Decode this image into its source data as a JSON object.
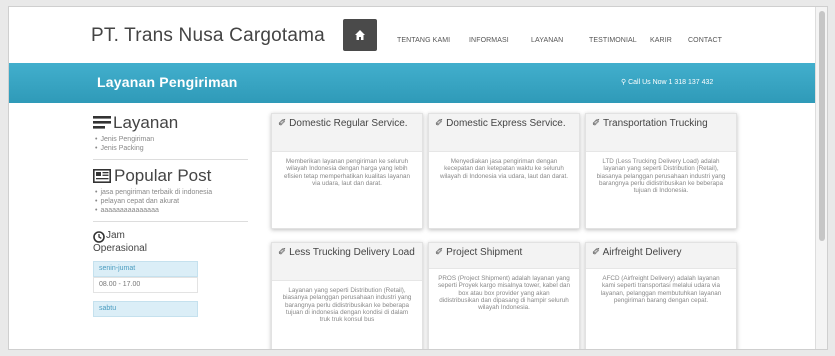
{
  "header": {
    "brand": "PT. Trans Nusa Cargotama",
    "home_icon": "home-icon",
    "nav": [
      "TENTANG KAMI",
      "INFORMASI",
      "LAYANAN",
      "TESTIMONIAL",
      "KARIR",
      "CONTACT"
    ]
  },
  "banner": {
    "title": "Layanan Pengiriman",
    "call": "⚲ Call Us Now 1 318 137 432",
    "color": "#3aa6c5"
  },
  "sidebar": {
    "layanan": {
      "title": "Layanan",
      "icon": "list-icon",
      "items": [
        "Jenis Pengiriman",
        "Jenis Packing"
      ]
    },
    "popular": {
      "title": "Popular Post",
      "icon": "news-icon",
      "items": [
        "jasa pengiriman terbaik di indonesia",
        "pelayan cepat dan akurat",
        "aaaaaaaaaaaaaaa"
      ]
    },
    "jam": {
      "title_line1": "Jam",
      "title_line2": "Operasional",
      "icon": "clock-icon",
      "rows": [
        "senin-jumat",
        "08.00 - 17.00",
        "sabtu"
      ]
    }
  },
  "services": [
    {
      "title": "✐ Domestic Regular Service.",
      "text": "Memberikan layanan pengiriman ke seluruh wilayah Indonesia dengan harga yang lebih efisien tetap memperhatikan kualitas layanan via udara, laut dan darat."
    },
    {
      "title": "✐ Domestic Express Service.",
      "text": "Menyediakan jasa pengiriman dengan kecepatan dan ketepatan waktu ke seluruh wilayah di Indonesia via udara, laut dan darat."
    },
    {
      "title": "✐ Transportation Trucking",
      "text": "LTD (Less Trucking Delivery Load) adalah layanan yang seperti Distribution (Retail), biasanya pelanggan perusahaan industri yang barangnya perlu didistribusikan ke beberapa tujuan di Indonesia."
    },
    {
      "title": "✐ Less Trucking Delivery Load",
      "text": "Layanan yang seperti Distribution (Retail), biasanya pelanggan perusahaan industri yang barangnya perlu didistribusikan ke beberapa tujuan di indonesia dengan kondisi di dalam truk truk konsul bus"
    },
    {
      "title": "✐ Project Shipment",
      "text": "PROS (Project Shipment) adalah layanan yang seperti Proyek kargo misalnya tower, kabel dan box atau box provider yang akan didistribusikan dan dipasang di hampir seluruh wilayah Indonesia."
    },
    {
      "title": "✐ Airfreight Delivery",
      "text": "AFCD (Airfreight Delivery) adalah layanan kami seperti transportasi melalui udara via layanan, pelanggan membutuhkan layanan pengiriman barang dengan cepat."
    }
  ]
}
